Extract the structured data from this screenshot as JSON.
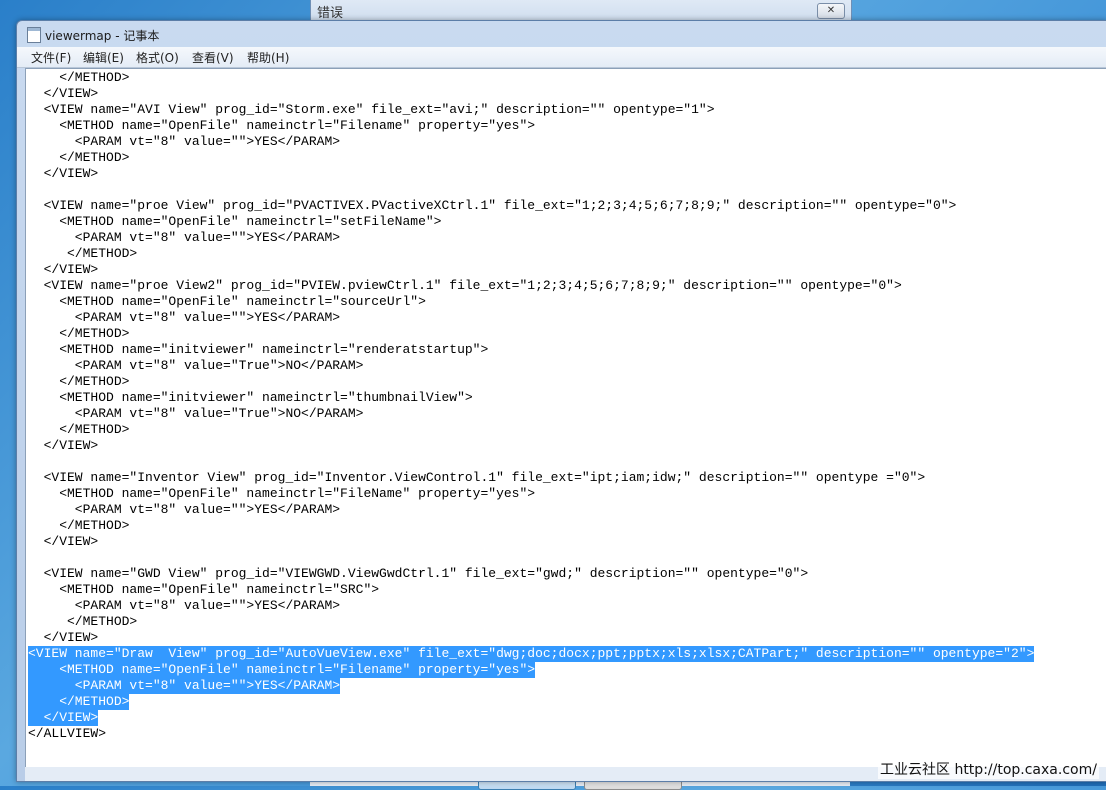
{
  "error_dialog": {
    "title": "错误",
    "close_glyph": "✕"
  },
  "window": {
    "title": "viewermap - 记事本",
    "icon": "notepad-icon"
  },
  "menu": [
    {
      "label": "文件(F)"
    },
    {
      "label": "编辑(E)"
    },
    {
      "label": "格式(O)"
    },
    {
      "label": "查看(V)"
    },
    {
      "label": "帮助(H)"
    }
  ],
  "lines": [
    "    </METHOD>",
    "  </VIEW>",
    "  <VIEW name=\"AVI View\" prog_id=\"Storm.exe\" file_ext=\"avi;\" description=\"\" opentype=\"1\">",
    "    <METHOD name=\"OpenFile\" nameinctrl=\"Filename\" property=\"yes\">",
    "      <PARAM vt=\"8\" value=\"\">YES</PARAM>",
    "    </METHOD>",
    "  </VIEW>",
    "",
    "  <VIEW name=\"proe View\" prog_id=\"PVACTIVEX.PVactiveXCtrl.1\" file_ext=\"1;2;3;4;5;6;7;8;9;\" description=\"\" opentype=\"0\">",
    "    <METHOD name=\"OpenFile\" nameinctrl=\"setFileName\">",
    "      <PARAM vt=\"8\" value=\"\">YES</PARAM>",
    "     </METHOD>",
    "  </VIEW>",
    "  <VIEW name=\"proe View2\" prog_id=\"PVIEW.pviewCtrl.1\" file_ext=\"1;2;3;4;5;6;7;8;9;\" description=\"\" opentype=\"0\">",
    "    <METHOD name=\"OpenFile\" nameinctrl=\"sourceUrl\">",
    "      <PARAM vt=\"8\" value=\"\">YES</PARAM>",
    "    </METHOD>",
    "    <METHOD name=\"initviewer\" nameinctrl=\"renderatstartup\">",
    "      <PARAM vt=\"8\" value=\"True\">NO</PARAM>",
    "    </METHOD>",
    "    <METHOD name=\"initviewer\" nameinctrl=\"thumbnailView\">",
    "      <PARAM vt=\"8\" value=\"True\">NO</PARAM>",
    "    </METHOD>",
    "  </VIEW>",
    "",
    "  <VIEW name=\"Inventor View\" prog_id=\"Inventor.ViewControl.1\" file_ext=\"ipt;iam;idw;\" description=\"\" opentype =\"0\">",
    "    <METHOD name=\"OpenFile\" nameinctrl=\"FileName\" property=\"yes\">",
    "      <PARAM vt=\"8\" value=\"\">YES</PARAM>",
    "    </METHOD>",
    "  </VIEW>",
    "",
    "  <VIEW name=\"GWD View\" prog_id=\"VIEWGWD.ViewGwdCtrl.1\" file_ext=\"gwd;\" description=\"\" opentype=\"0\">",
    "    <METHOD name=\"OpenFile\" nameinctrl=\"SRC\">",
    "      <PARAM vt=\"8\" value=\"\">YES</PARAM>",
    "     </METHOD>",
    "  </VIEW>",
    "<VIEW name=\"Draw  View\" prog_id=\"AutoVueView.exe\" file_ext=\"dwg;doc;docx;ppt;pptx;xls;xlsx;CATPart;\" description=\"\" opentype=\"2\">",
    "    <METHOD name=\"OpenFile\" nameinctrl=\"Filename\" property=\"yes\">",
    "      <PARAM vt=\"8\" value=\"\">YES</PARAM>",
    "    </METHOD>",
    "  </VIEW>",
    "</ALLVIEW>"
  ],
  "selected_line_range": [
    36,
    40
  ],
  "watermark": "工业云社区 http://top.caxa.com/",
  "colors": {
    "selection": "#3399ff",
    "selection_text": "#ffffff"
  }
}
